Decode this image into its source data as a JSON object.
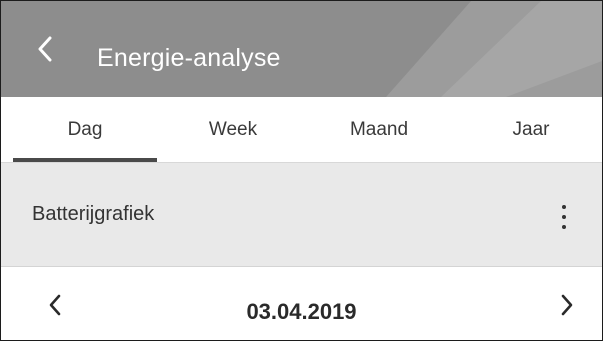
{
  "header": {
    "title": "Energie-analyse",
    "back_icon": "chevron-left-icon",
    "background_color": "#8a8a8a"
  },
  "tabs": [
    {
      "label": "Dag",
      "active": true
    },
    {
      "label": "Week",
      "active": false
    },
    {
      "label": "Maand",
      "active": false
    },
    {
      "label": "Jaar",
      "active": false
    }
  ],
  "section": {
    "label": "Batterijgrafiek",
    "menu_icon": "more-vertical-icon"
  },
  "date_nav": {
    "date": "03.04.2019",
    "prev_icon": "chevron-left-icon",
    "next_icon": "chevron-right-icon"
  }
}
